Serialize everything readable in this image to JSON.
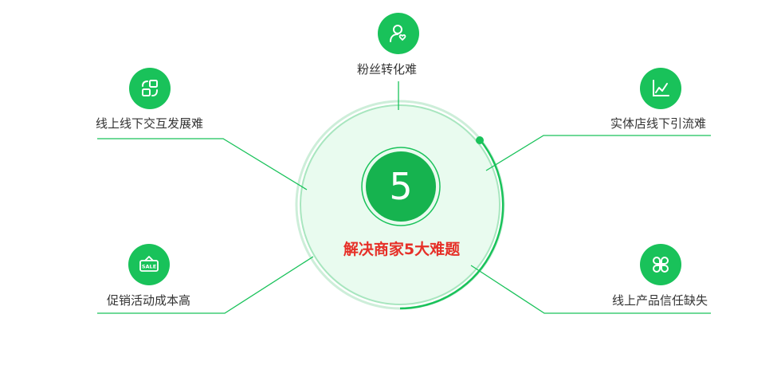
{
  "center": {
    "number": "5",
    "title": "解决商家5大难题"
  },
  "items": {
    "top": "粉丝转化难",
    "top_left": "线上线下交互发展难",
    "top_right": "实体店线下引流难",
    "bottom_left": "促销活动成本高",
    "bottom_right": "线上产品信任缺失"
  },
  "sale_tag_text": "SALE",
  "colors": {
    "accent": "#19c25a",
    "title_red": "#e63028",
    "inner_fill": "#e9fbef"
  },
  "icons": {
    "top": "user-heart-icon",
    "top_left": "refresh-grid-icon",
    "top_right": "line-chart-icon",
    "bottom_left": "sale-tag-icon",
    "bottom_right": "clover-icon"
  }
}
